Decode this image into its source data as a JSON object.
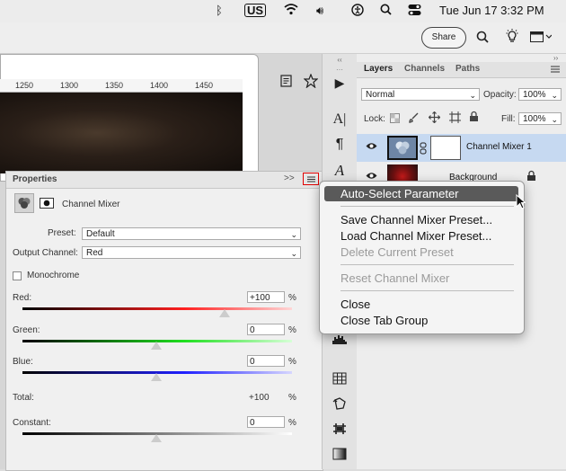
{
  "menubar": {
    "keyboard_layout": "US",
    "datetime": "Tue Jun 17  3:32 PM"
  },
  "options_bar": {
    "share_label": "Share"
  },
  "ruler": {
    "ticks": [
      "1250",
      "1300",
      "1350",
      "1400",
      "1450"
    ]
  },
  "properties": {
    "title": "Properties",
    "expand_glyph": ">>",
    "panel_name": "Channel Mixer",
    "preset_label": "Preset:",
    "preset_value": "Default",
    "output_label": "Output Channel:",
    "output_value": "Red",
    "monochrome_label": "Monochrome",
    "monochrome_checked": false,
    "sliders": [
      {
        "label": "Red:",
        "value": "+100",
        "unit": "%",
        "level_percent": 100,
        "color": "#e02020"
      },
      {
        "label": "Green:",
        "value": "0",
        "unit": "%",
        "level_percent": 0,
        "color": "#20d020"
      },
      {
        "label": "Blue:",
        "value": "0",
        "unit": "%",
        "level_percent": 0,
        "color": "#2020e0"
      }
    ],
    "total_label": "Total:",
    "total_value": "+100",
    "total_unit": "%",
    "constant_label": "Constant:",
    "constant_value": "0",
    "constant_unit": "%",
    "constant_level_percent": 0
  },
  "layers": {
    "tabs": [
      "Layers",
      "Channels",
      "Paths"
    ],
    "blend_mode": "Normal",
    "opacity_label": "Opacity:",
    "opacity_value": "100%",
    "lock_label": "Lock:",
    "fill_label": "Fill:",
    "fill_value": "100%",
    "items": [
      {
        "name": "Channel Mixer 1",
        "selected": true
      },
      {
        "name": "Background",
        "selected": false,
        "locked": true
      }
    ]
  },
  "context_menu": {
    "items": [
      {
        "label": "Auto-Select Parameter",
        "enabled": true,
        "highlighted": true
      },
      {
        "label": "Save Channel Mixer Preset...",
        "enabled": true
      },
      {
        "label": "Load Channel Mixer Preset...",
        "enabled": true
      },
      {
        "label": "Delete Current Preset",
        "enabled": false
      },
      {
        "label": "Reset Channel Mixer",
        "enabled": false
      },
      {
        "label": "Close",
        "enabled": true
      },
      {
        "label": "Close Tab Group",
        "enabled": true
      }
    ]
  },
  "colors": {
    "menu_highlight": "#5a5a5a",
    "panel_menu_outline": "#e00000",
    "selected_layer": "#c6d9f1"
  }
}
